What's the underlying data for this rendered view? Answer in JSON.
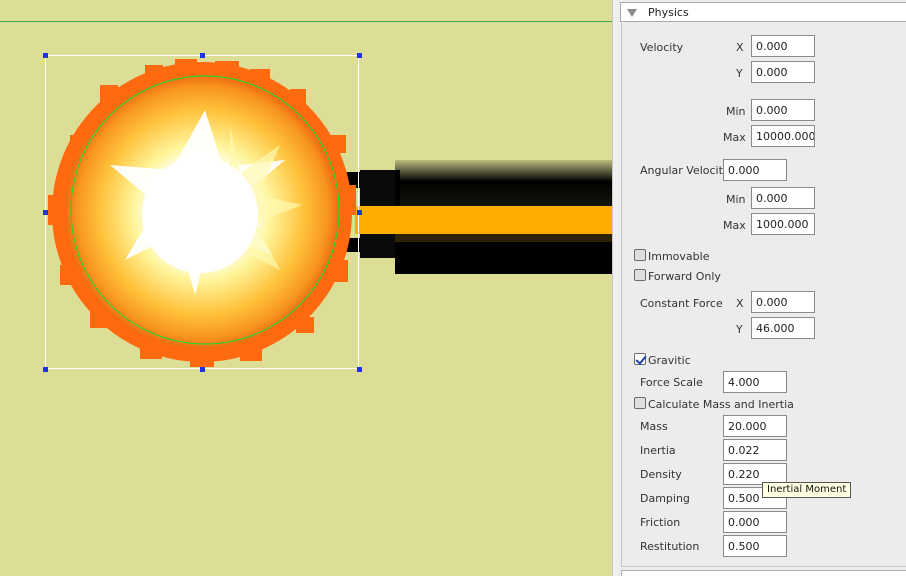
{
  "panel": {
    "title": "Physics",
    "velocity": {
      "label": "Velocity",
      "x_label": "X",
      "x": "0.000",
      "y_label": "Y",
      "y": "0.000",
      "min_label": "Min",
      "min": "0.000",
      "max_label": "Max",
      "max": "10000.000"
    },
    "angular": {
      "label": "Angular Velocity",
      "value": "0.000",
      "min_label": "Min",
      "min": "0.000",
      "max_label": "Max",
      "max": "1000.000"
    },
    "immovable": {
      "label": "Immovable",
      "checked": false
    },
    "forward_only": {
      "label": "Forward Only",
      "checked": false
    },
    "constant_force": {
      "label": "Constant Force",
      "x_label": "X",
      "x": "0.000",
      "y_label": "Y",
      "y": "46.000"
    },
    "gravitic": {
      "label": "Gravitic",
      "checked": true
    },
    "force_scale": {
      "label": "Force Scale",
      "value": "4.000"
    },
    "calc_mass": {
      "label": "Calculate Mass and Inertia",
      "checked": false
    },
    "mass": {
      "label": "Mass",
      "value": "20.000"
    },
    "inertia": {
      "label": "Inertia",
      "value": "0.022"
    },
    "density": {
      "label": "Density",
      "value": "0.220"
    },
    "damping": {
      "label": "Damping",
      "value": "0.500"
    },
    "friction": {
      "label": "Friction",
      "value": "0.000"
    },
    "restitution": {
      "label": "Restitution",
      "value": "0.500"
    }
  },
  "tooltip": {
    "text": "Inertial Moment"
  },
  "colors": {
    "canvas": "#dcde96",
    "beam_orange": "#ffad00",
    "selection_handle": "#1f32e6",
    "collision_circle": "#2fd12f"
  }
}
